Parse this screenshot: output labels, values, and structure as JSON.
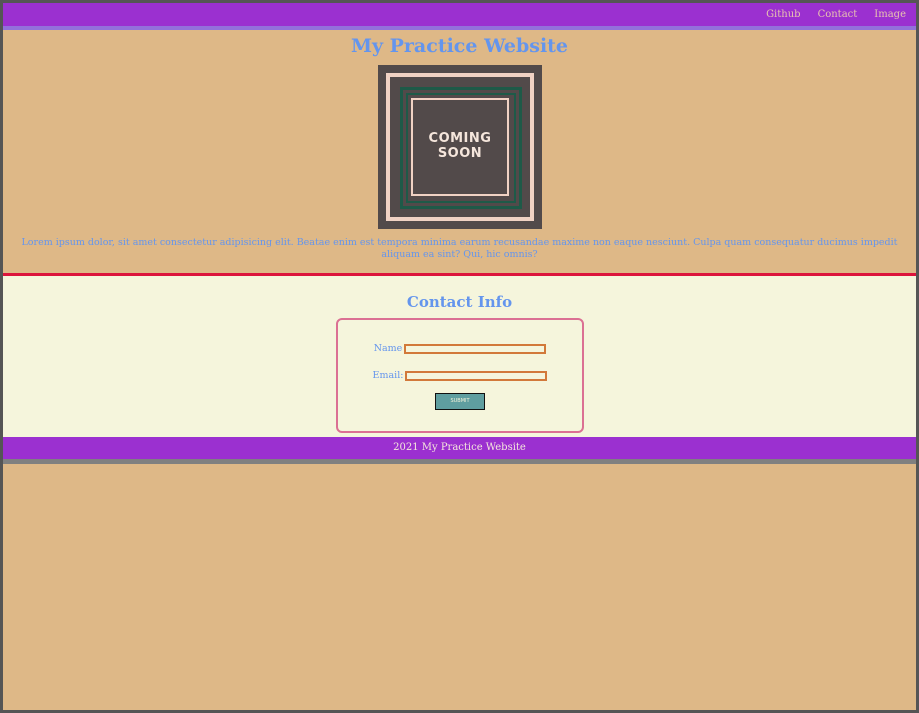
{
  "nav": {
    "links": [
      "Github",
      "Contact",
      "Image"
    ]
  },
  "hero": {
    "title": "My Practice Website",
    "image_text_line1": "COMING",
    "image_text_line2": "SOON",
    "lorem": "Lorem ipsum dolor, sit amet consectetur adipisicing elit. Beatae enim est tempora minima earum recusandae maxime non eaque nesciunt. Culpa quam consequatur ducimus impedit aliquam ea sint? Qui, hic omnis?"
  },
  "contact": {
    "title": "Contact Info",
    "name_label": "Name",
    "name_value": "",
    "email_label": "Email:",
    "email_value": "",
    "submit_label": "SUBMIT"
  },
  "footer": {
    "text": "2021 My Practice Website"
  },
  "colors": {
    "nav_bg": "#9b30d0",
    "page_bg": "#deb887",
    "heading": "#6495ed",
    "contact_bg": "#f5f5dc",
    "divider": "#dc143c",
    "form_border": "#db7093",
    "input_border": "#d2793a",
    "button_bg": "#5f9ea0"
  }
}
